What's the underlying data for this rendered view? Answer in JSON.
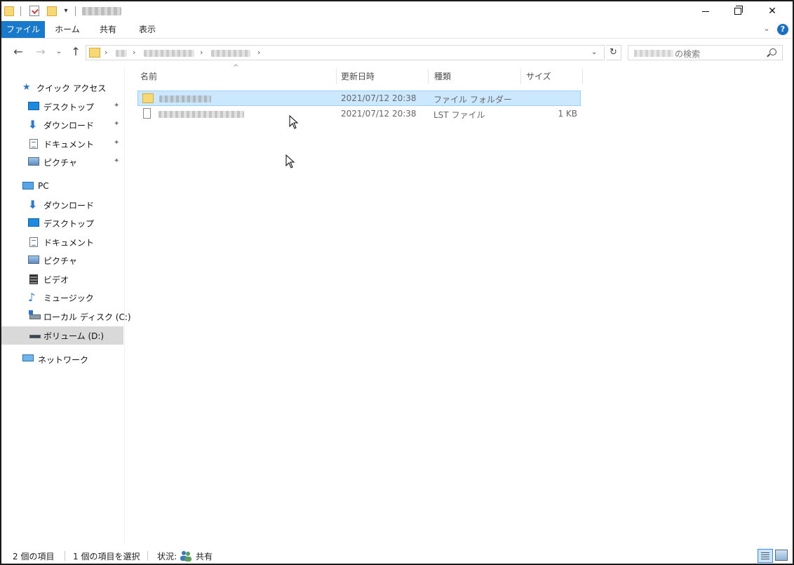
{
  "ribbon": {
    "tabs": [
      "ファイル",
      "ホーム",
      "共有",
      "表示"
    ],
    "help": "?"
  },
  "window_controls": {
    "close": "✕"
  },
  "address": {
    "search_suffix": "の検索"
  },
  "sidebar": {
    "quick_access": {
      "label": "クイック アクセス",
      "icon": "star-icon"
    },
    "quick_items": [
      {
        "label": "デスクトップ",
        "icon": "desktop-icon",
        "pinned": true
      },
      {
        "label": "ダウンロード",
        "icon": "download-icon",
        "pinned": true
      },
      {
        "label": "ドキュメント",
        "icon": "document-icon",
        "pinned": true
      },
      {
        "label": "ピクチャ",
        "icon": "pictures-icon",
        "pinned": true
      }
    ],
    "pc": {
      "label": "PC",
      "icon": "pc-icon"
    },
    "pc_items": [
      {
        "label": "ダウンロード",
        "icon": "download-icon"
      },
      {
        "label": "デスクトップ",
        "icon": "desktop-icon"
      },
      {
        "label": "ドキュメント",
        "icon": "document-icon"
      },
      {
        "label": "ピクチャ",
        "icon": "pictures-icon"
      },
      {
        "label": "ビデオ",
        "icon": "video-icon"
      },
      {
        "label": "ミュージック",
        "icon": "music-icon"
      },
      {
        "label": "ローカル ディスク (C:)",
        "icon": "local-disk-icon"
      },
      {
        "label": "ボリューム (D:)",
        "icon": "volume-icon",
        "selected": true
      }
    ],
    "network": {
      "label": "ネットワーク",
      "icon": "network-icon"
    }
  },
  "columns": {
    "name": "名前",
    "modified": "更新日時",
    "type": "種類",
    "size": "サイズ"
  },
  "files": [
    {
      "modified": "2021/07/12 20:38",
      "type": "ファイル フォルダー",
      "size": "",
      "icon": "folder-icon",
      "selected": true
    },
    {
      "modified": "2021/07/12 20:38",
      "type": "LST ファイル",
      "size": "1 KB",
      "icon": "file-icon",
      "selected": false
    }
  ],
  "status": {
    "item_count": "2 個の項目",
    "selected_count": "1 個の項目を選択",
    "state_label": "状況:",
    "state_value": "共有"
  },
  "colors": {
    "accent": "#1979ca",
    "selection": "#cce8ff",
    "selection_border": "#99d1ff",
    "folder": "#f8d775"
  }
}
